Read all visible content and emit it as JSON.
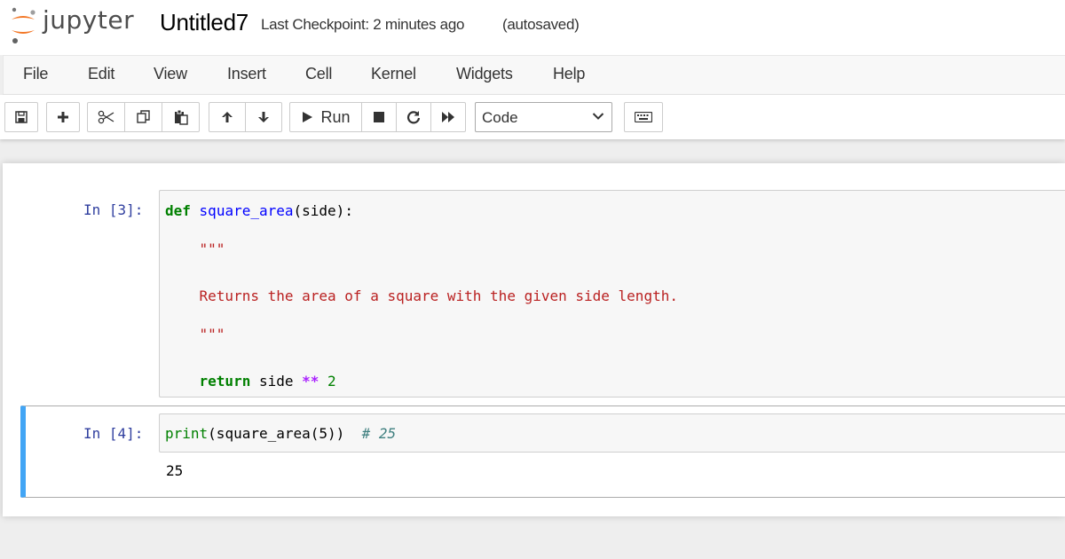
{
  "app": {
    "logo_text": "jupyter",
    "notebook_name": "Untitled7",
    "checkpoint": "Last Checkpoint: 2 minutes ago",
    "autosave": "(autosaved)"
  },
  "menu": {
    "items": [
      "File",
      "Edit",
      "View",
      "Insert",
      "Cell",
      "Kernel",
      "Widgets",
      "Help"
    ]
  },
  "toolbar": {
    "buttons": [
      "save-icon",
      "plus-icon",
      "cut-icon",
      "copy-icon",
      "paste-icon",
      "arrow-up-icon",
      "arrow-down-icon",
      "run-icon",
      "stop-icon",
      "restart-icon",
      "fast-forward-icon",
      "keyboard-icon"
    ],
    "run_label": "Run",
    "cell_type": "Code"
  },
  "cells": [
    {
      "prompt": "In [3]:",
      "code": [
        [
          "def",
          " ",
          "square_area",
          "(side):"
        ],
        [
          "    ",
          "\"\"\""
        ],
        [
          "    ",
          "Returns the area of a square with the given side length."
        ],
        [
          "    ",
          "\"\"\""
        ],
        [
          "    ",
          "return",
          " side ",
          "**",
          " ",
          "2"
        ]
      ]
    },
    {
      "prompt": "In [4]:",
      "code_parts": [
        "print",
        "(square_area(5))  ",
        "# 25"
      ],
      "output": "25"
    }
  ],
  "colors": {
    "prompt": "#303f9f",
    "keyword": "#008000",
    "function": "#0000ff",
    "string": "#ba2121",
    "operator": "#aa22ff",
    "comment": "#408080",
    "selected_border": "#42a5f5",
    "logo_orange": "#f37726"
  }
}
